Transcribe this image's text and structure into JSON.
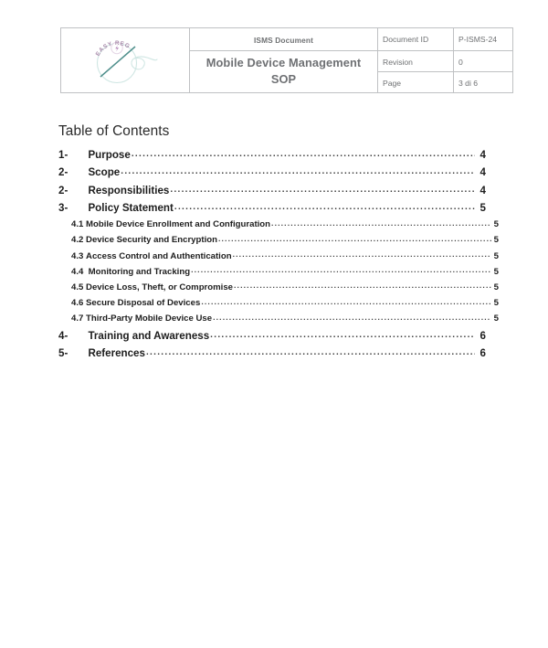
{
  "document": {
    "header": {
      "logo": {
        "icon_name": "easy-reg-logo",
        "arc_text": "EASY REG",
        "circle_color": "#cfe6e3",
        "arc_text_color": "#a98bab",
        "slash_color": "#4f8f8c"
      },
      "category_label": "ISMS Document",
      "title": "Mobile Device Management SOP",
      "title_line1": "Mobile Device Management",
      "title_line2": "SOP",
      "meta_rows": [
        {
          "key": "Document ID",
          "value": "P-ISMS-24"
        },
        {
          "key": "Revision",
          "value": "0"
        },
        {
          "key": "Page",
          "value": "3 di 6"
        }
      ],
      "border_color": "#bfc1c3",
      "text_color": "#6f7173"
    },
    "toc": {
      "heading": "Table of Contents",
      "entries": [
        {
          "level": 1,
          "number": "1-",
          "label": "Purpose",
          "page": "4"
        },
        {
          "level": 1,
          "number": "2-",
          "label": "Scope",
          "page": "4"
        },
        {
          "level": 1,
          "number": "2-",
          "label": "Responsibilities",
          "page": "4"
        },
        {
          "level": 1,
          "number": "3-",
          "label": "Policy Statement",
          "page": "5"
        },
        {
          "level": 2,
          "number": "4.1",
          "label": "Mobile Device Enrollment and Configuration",
          "page": "5"
        },
        {
          "level": 2,
          "number": "4.2",
          "label": "Device Security and Encryption",
          "page": "5"
        },
        {
          "level": 2,
          "number": "4.3",
          "label": "Access Control and Authentication",
          "page": "5"
        },
        {
          "level": 2,
          "number": "4.4",
          "label": " Monitoring and Tracking",
          "page": "5"
        },
        {
          "level": 2,
          "number": "4.5",
          "label": "Device Loss, Theft, or Compromise",
          "page": "5"
        },
        {
          "level": 2,
          "number": "4.6",
          "label": "Secure Disposal of Devices",
          "page": "5"
        },
        {
          "level": 2,
          "number": "4.7",
          "label": "Third-Party Mobile Device Use",
          "page": "5"
        },
        {
          "level": 1,
          "number": "4-",
          "label": "Training and Awareness",
          "page": "6"
        },
        {
          "level": 1,
          "number": "5-",
          "label": "References",
          "page": "6"
        }
      ]
    }
  }
}
